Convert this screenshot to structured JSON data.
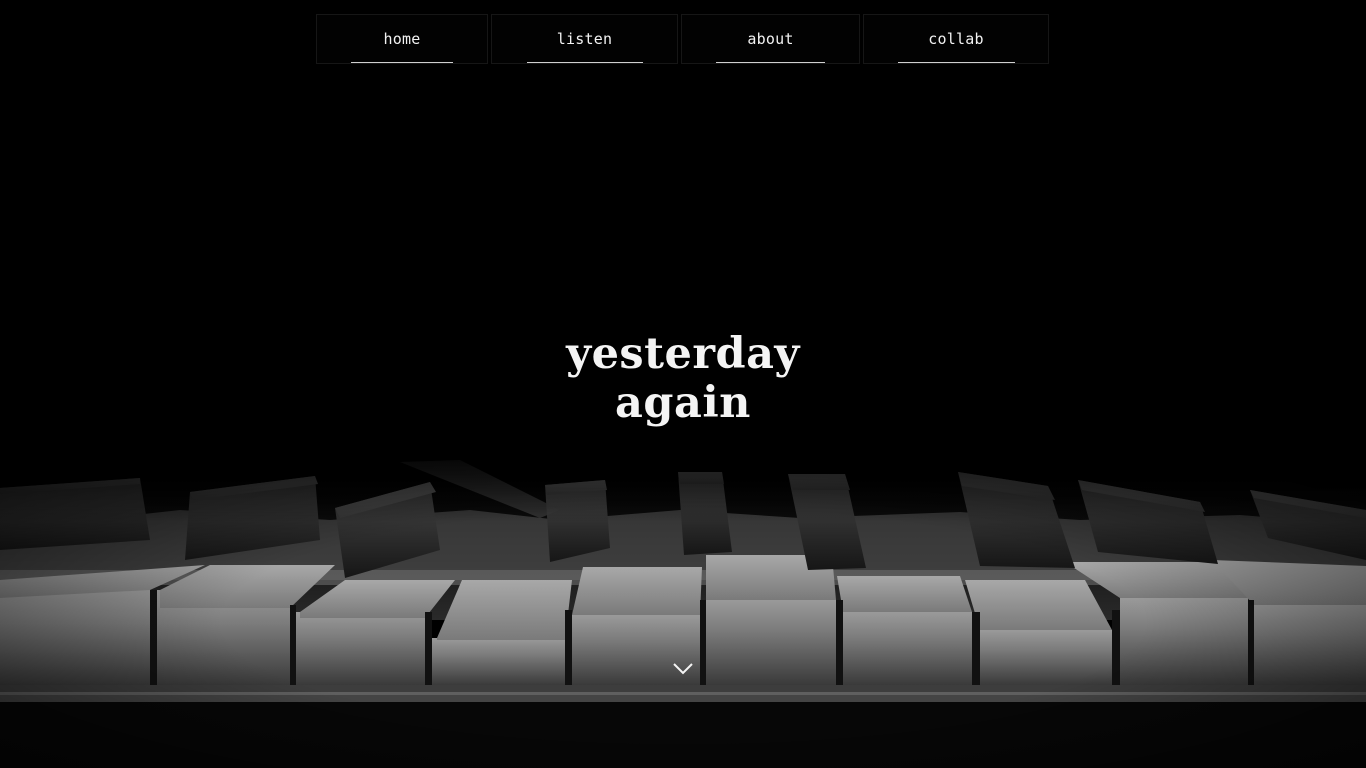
{
  "nav": {
    "items": [
      {
        "label": "home"
      },
      {
        "label": "listen"
      },
      {
        "label": "about"
      },
      {
        "label": "collab"
      }
    ]
  },
  "hero": {
    "title_line1": "yesterday",
    "title_line2": "again",
    "background": "piano-keys-photo",
    "scroll_icon": "chevron-down-icon"
  },
  "colors": {
    "background": "#000000",
    "text": "#f4f4f4",
    "key_ivory": "#8f8f8f",
    "key_ebony": "#2a2a2a"
  }
}
